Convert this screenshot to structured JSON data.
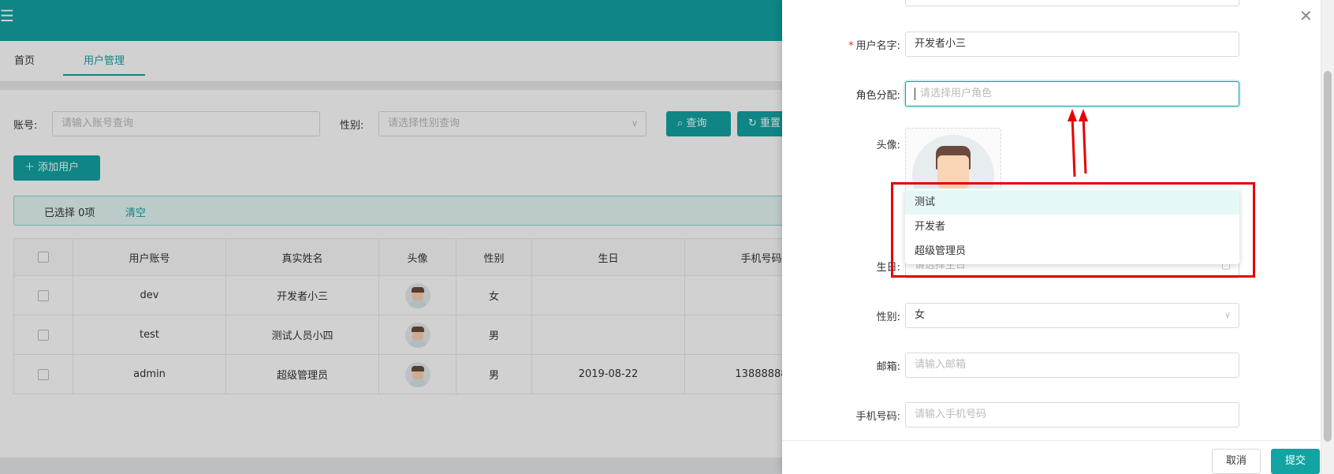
{
  "colors": {
    "brand": "#13a3a3",
    "highlight": "#e60000"
  },
  "header": {
    "menu_icon": "hamburger-icon"
  },
  "tabs": [
    {
      "label": "首页"
    },
    {
      "label": "用户管理"
    }
  ],
  "search": {
    "account_label": "账号:",
    "account_placeholder": "请输入账号查询",
    "gender_label": "性别:",
    "gender_placeholder": "请选择性别查询",
    "query_button": "查询",
    "reset_button": "重置"
  },
  "toolbar": {
    "add_user_button": "添加用户"
  },
  "selection": {
    "selected_text": "已选择",
    "selected_count": "0项",
    "clear_link": "清空"
  },
  "table": {
    "columns": [
      "用户账号",
      "真实姓名",
      "头像",
      "性别",
      "生日",
      "手机号码"
    ],
    "rows": [
      {
        "account": "dev",
        "name": "开发者小三",
        "gender": "女",
        "birthday": "",
        "phone": ""
      },
      {
        "account": "test",
        "name": "测试人员小四",
        "gender": "男",
        "birthday": "",
        "phone": ""
      },
      {
        "account": "admin",
        "name": "超级管理员",
        "gender": "男",
        "birthday": "2019-08-22",
        "phone": "13888888"
      }
    ]
  },
  "drawer": {
    "close_icon": "close-icon",
    "username_label": "用户名字:",
    "username_value": "开发者小三",
    "role_label": "角色分配:",
    "role_placeholder": "请选择用户角色",
    "avatar_label": "头像:",
    "role_options": [
      "测试",
      "开发者",
      "超级管理员"
    ],
    "birthday_label": "生日:",
    "birthday_placeholder": "请选择生日",
    "gender_label": "性别:",
    "gender_value": "女",
    "email_label": "邮箱:",
    "email_placeholder": "请输入邮箱",
    "phone_label": "手机号码:",
    "phone_placeholder": "请输入手机号码",
    "cancel_button": "取消",
    "submit_button": "提交"
  }
}
